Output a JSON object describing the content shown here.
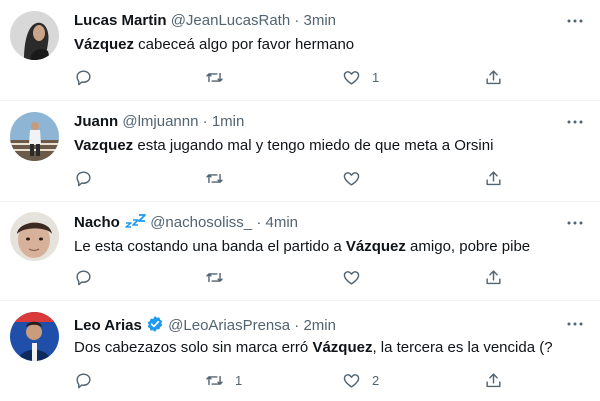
{
  "tweets": [
    {
      "name": "Lucas Martin",
      "handle": "@JeanLucasRath",
      "sep": "·",
      "time": "3min",
      "bold": "Vázquez",
      "text": " cabeceá algo por favor hermano",
      "replies": "",
      "retweets": "",
      "likes": "1"
    },
    {
      "name": "Juann",
      "handle": "@lmjuannn",
      "sep": "·",
      "time": "1min",
      "bold": "Vazquez",
      "text": " esta jugando mal y tengo miedo de que meta a Orsini",
      "replies": "",
      "retweets": "",
      "likes": ""
    },
    {
      "name": "Nacho",
      "name_emoji": "💤",
      "handle": "@nachosoliss_",
      "sep": "·",
      "time": "4min",
      "pre": "Le esta costando una banda el partido a ",
      "bold": "Vázquez",
      "text": " amigo, pobre pibe",
      "replies": "",
      "retweets": "",
      "likes": ""
    },
    {
      "name": "Leo Arias",
      "verified": true,
      "handle": "@LeoAriasPrensa",
      "sep": "·",
      "time": "2min",
      "pre": "Dos cabezazos solo sin marca erró ",
      "bold": "Vázquez",
      "text": ", la tercera es la vencida (?",
      "replies": "",
      "retweets": "1",
      "likes": "2"
    }
  ],
  "colors": {
    "text": "#0f1419",
    "secondary": "#536471",
    "divider": "#eff3f4",
    "verified": "#1d9bf0"
  }
}
